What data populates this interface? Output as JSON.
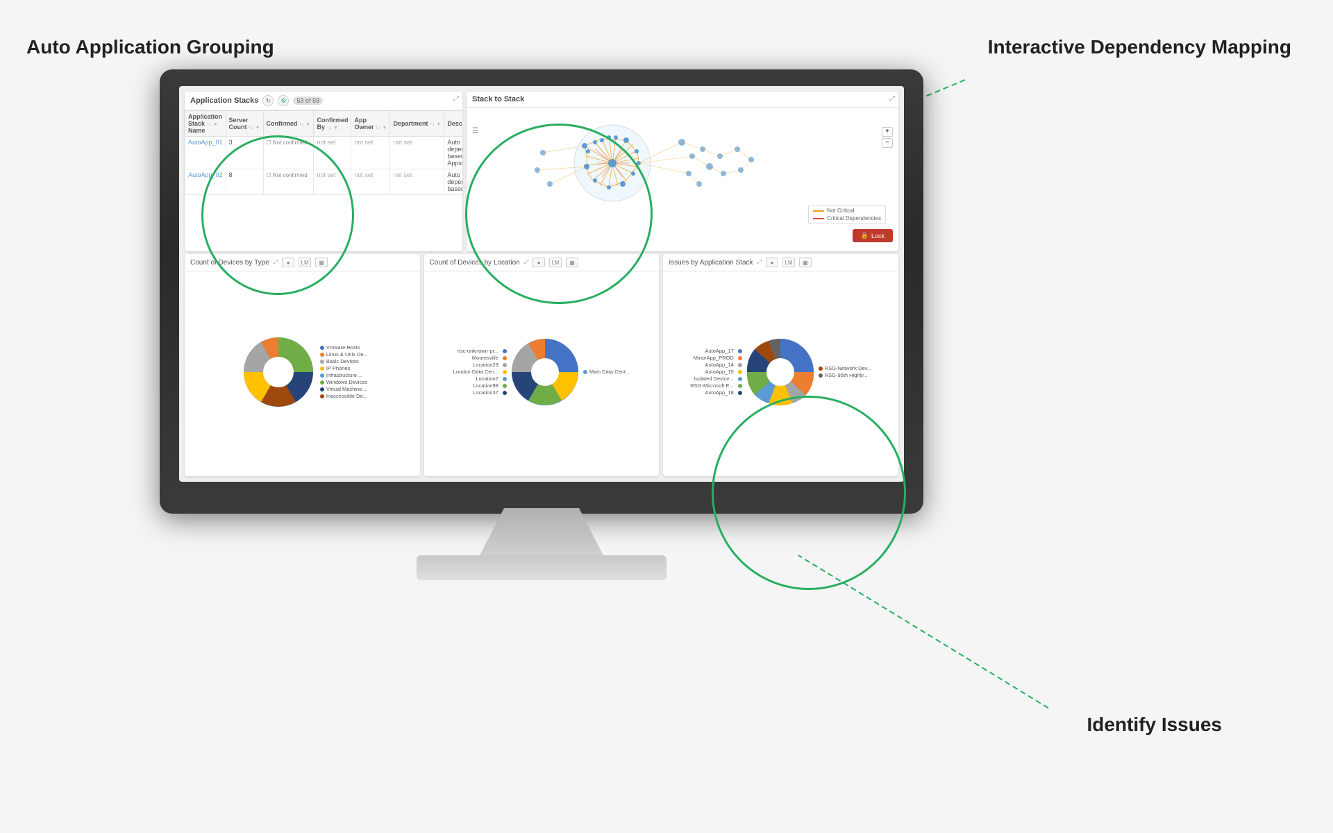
{
  "annotations": {
    "aag_label": "Auto Application Grouping",
    "idm_label": "Interactive Dependency Mapping",
    "ii_label": "Identify Issues"
  },
  "app_stacks_panel": {
    "title": "Application Stacks",
    "badge": "59 of 59",
    "columns": [
      "Application Stack Name",
      "Server Count",
      "Confirmed",
      "Confirmed By",
      "App Owner",
      "Department",
      "Description"
    ],
    "rows": [
      {
        "name": "AutoApp_01",
        "server_count": "3",
        "confirmed": "Not confirmed",
        "confirmed_by": "not set",
        "app_owner": "not set",
        "department": "not set",
        "description": "Auto dependency-based Appstack"
      },
      {
        "name": "AutoApp_02",
        "server_count": "8",
        "confirmed": "Not confirmed",
        "confirmed_by": "not set",
        "app_owner": "not set",
        "department": "not set",
        "description": "Auto dependency-based"
      }
    ]
  },
  "stack_panel": {
    "title": "Stack to Stack",
    "legend": {
      "not_critical": "Not Critical",
      "critical": "Critical Dependencies"
    },
    "lock_label": "Lock"
  },
  "chart1": {
    "title": "Count of Devices by Type",
    "labels": [
      "Vmware Hosts",
      "Linux & Unix De...",
      "Basic Devices",
      "IP Phones",
      "Infrastructure ...",
      "Windows Devices",
      "Virtual Machine...",
      "Inaccessible De..."
    ],
    "colors": [
      "#4472c4",
      "#ed7d31",
      "#a5a5a5",
      "#ffc000",
      "#5b9bd5",
      "#70ad47",
      "#264478",
      "#9e480e"
    ]
  },
  "chart2": {
    "title": "Count of Devices by Location",
    "labels": [
      "risc-unknown-pr...",
      "Mooresville",
      "Location29",
      "London Data Cen...",
      "Location7",
      "Location98",
      "Location37",
      "Main Data Cent..."
    ],
    "colors": [
      "#4472c4",
      "#ed7d31",
      "#a5a5a5",
      "#ffc000",
      "#5b9bd5",
      "#70ad47",
      "#264478",
      "#9e480e"
    ]
  },
  "chart3": {
    "title": "Issues by Application Stack",
    "labels": [
      "AutoApp_17",
      "MinorApp_PROD",
      "AutoApp_14",
      "AutoApp_15",
      "Isolated Device...",
      "RSG-Microsoft E...",
      "AutoApp_18",
      "RSG-95th Highly...",
      "RSG-Network Dev..."
    ],
    "colors": [
      "#4472c4",
      "#ed7d31",
      "#a5a5a5",
      "#ffc000",
      "#5b9bd5",
      "#70ad47",
      "#264478",
      "#9e480e",
      "#636363"
    ]
  }
}
